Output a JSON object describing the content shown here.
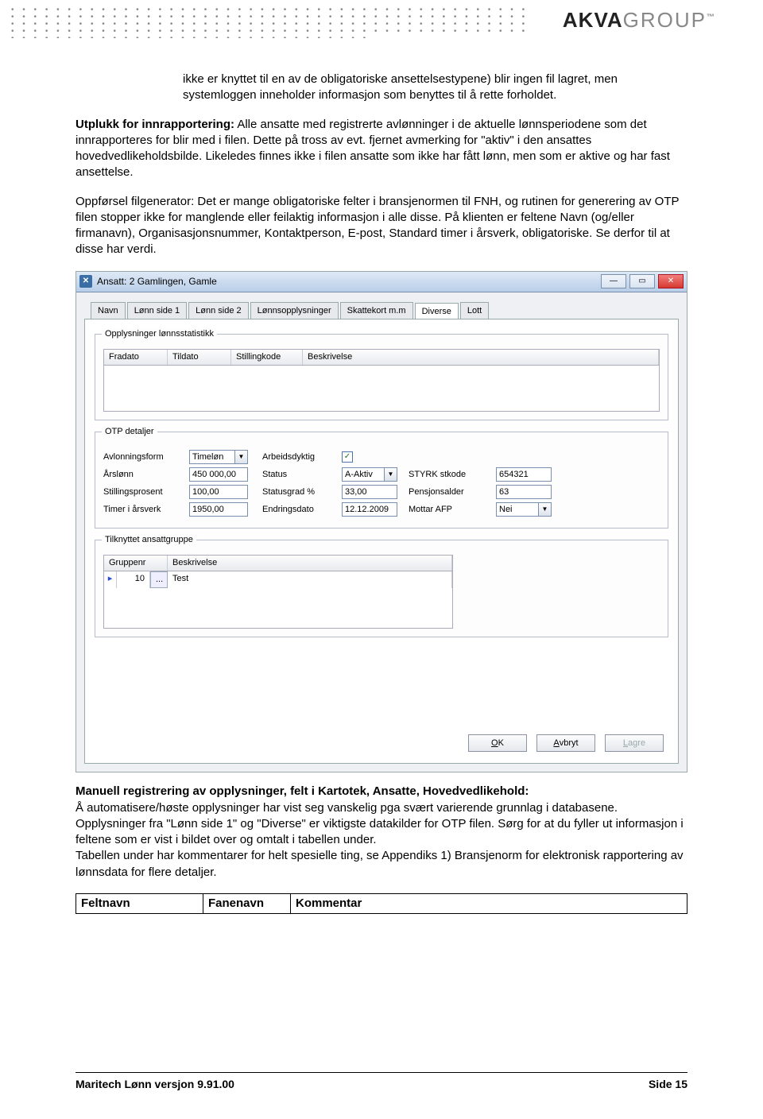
{
  "logo": {
    "brand": "AKVA",
    "suffix": "GROUP"
  },
  "text": {
    "p0": "ikke er knyttet til en av de obligatoriske ansettelsestypene) blir ingen fil lagret, men systemloggen inneholder informasjon som benyttes til å rette forholdet.",
    "p1_lead": "Utplukk for innrapportering:",
    "p1_rest": " Alle ansatte med registrerte avlønninger i de aktuelle lønnsperiodene som det innrapporteres for blir med i filen. Dette på tross av evt. fjernet avmerking for \"aktiv\" i den ansattes hovedvedlikeholdsbilde. Likeledes finnes ikke i filen ansatte som ikke har fått lønn, men som er aktive og har fast ansettelse.",
    "p2": "Oppførsel filgenerator: Det er mange obligatoriske felter i bransjenormen til FNH, og rutinen for generering av OTP filen stopper ikke for manglende eller feilaktig informasjon i alle disse. På klienten er feltene Navn (og/eller firmanavn), Organisasjonsnummer, Kontaktperson, E-post, Standard timer i årsverk, obligatoriske. Se derfor til at disse har verdi.",
    "h2": "Manuell registrering av opplysninger, felt i Kartotek, Ansatte, Hovedvedlikehold:",
    "p3": "Å automatisere/høste opplysninger har vist seg vanskelig pga svært varierende grunnlag i databasene. Opplysninger fra \"Lønn side 1\" og \"Diverse\" er viktigste datakilder for OTP filen. Sørg for at du fyller ut informasjon i feltene som er vist i bildet over og omtalt i tabellen under.",
    "p4": "Tabellen under har kommentarer for helt spesielle ting, se Appendiks 1) Bransjenorm for elektronisk rapportering av lønnsdata for flere detaljer."
  },
  "window": {
    "title": "Ansatt:  2  Gamlingen, Gamle",
    "tabs": [
      "Navn",
      "Lønn side 1",
      "Lønn side 2",
      "Lønnsopplysninger",
      "Skattekort m.m",
      "Diverse",
      "Lott"
    ],
    "active_tab": 5,
    "group_stats": {
      "legend": "Opplysninger lønnsstatistikk",
      "cols": [
        "Fradato",
        "Tildato",
        "Stillingkode",
        "Beskrivelse"
      ]
    },
    "group_otp": {
      "legend": "OTP detaljer",
      "labels": {
        "avlonningsform": "Avlonningsform",
        "arbeidsdyktig": "Arbeidsdyktig",
        "arslonn": "Årslønn",
        "status": "Status",
        "styrk": "STYRK stkode",
        "stillingsprosent": "Stillingsprosent",
        "statusgrad": "Statusgrad %",
        "pensjonsalder": "Pensjonsalder",
        "timer": "Timer i årsverk",
        "endringsdato": "Endringsdato",
        "mottar_afp": "Mottar AFP"
      },
      "values": {
        "avlonningsform": "Timeløn",
        "arslonn": "450 000,00",
        "status": "A-Aktiv",
        "styrk": "654321",
        "stillingsprosent": "100,00",
        "statusgrad": "33,00",
        "pensjonsalder": "63",
        "timer": "1950,00",
        "endringsdato": "12.12.2009",
        "mottar_afp": "Nei"
      }
    },
    "group_ansatt": {
      "legend": "Tilknyttet ansattgruppe",
      "cols": [
        "Gruppenr",
        "Beskrivelse"
      ],
      "row": {
        "gruppenr": "10",
        "beskrivelse": "Test",
        "ellipsis": "..."
      }
    },
    "buttons": {
      "ok": "OK",
      "avbryt": "Avbryt",
      "lagre": "Lagre"
    }
  },
  "table": {
    "headers": [
      "Feltnavn",
      "Fanenavn",
      "Kommentar"
    ]
  },
  "footer": {
    "left": "Maritech Lønn versjon 9.91.00",
    "right": "Side 15"
  }
}
